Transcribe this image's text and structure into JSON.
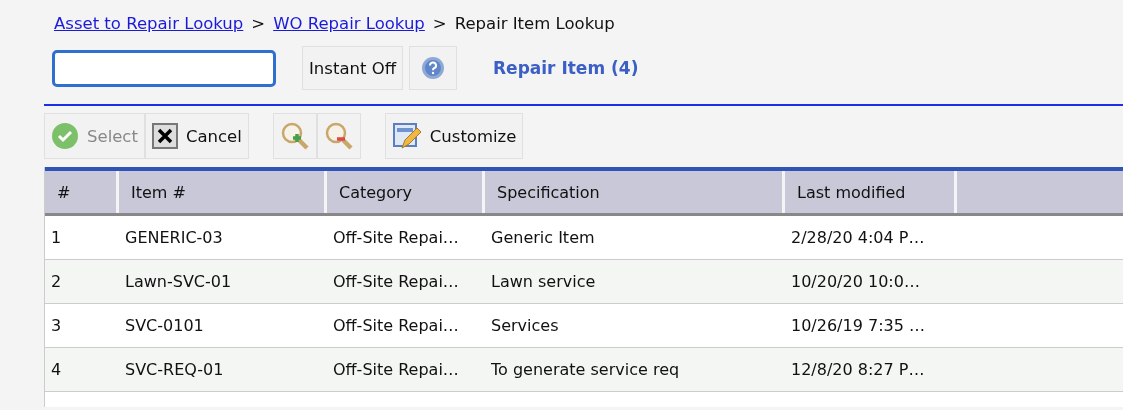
{
  "breadcrumb": [
    {
      "label": "Asset to Repair Lookup",
      "kind": "link"
    },
    {
      "label": "WO Repair Lookup",
      "kind": "link"
    },
    {
      "label": "Repair Item Lookup",
      "kind": "current"
    }
  ],
  "separator": ">",
  "instant_button": "Instant Off",
  "title": "Repair Item (4)",
  "toolbar": [
    {
      "kind": "select",
      "label": "Select",
      "disabled": true
    },
    {
      "kind": "cancel",
      "label": "Cancel",
      "disabled": false
    },
    {
      "kind": "zoom-in",
      "disabled": false
    },
    {
      "kind": "zoom-out",
      "disabled": false
    },
    {
      "kind": "customize",
      "label": "Customize",
      "disabled": false
    }
  ],
  "table": {
    "columns": [
      "#",
      "Item #",
      "Category",
      "Specification",
      "Last modified"
    ],
    "rows": [
      [
        "1",
        "GENERIC-03",
        "Off-Site Repai…",
        "Generic Item",
        "2/28/20 4:04 P…"
      ],
      [
        "2",
        "Lawn-SVC-01",
        "Off-Site Repai…",
        "Lawn service",
        "10/20/20 10:0…"
      ],
      [
        "3",
        "SVC-0101",
        "Off-Site Repai…",
        "Services",
        "10/26/19 7:35 …"
      ],
      [
        "4",
        "SVC-REQ-01",
        "Off-Site Repai…",
        "To generate service req",
        "12/8/20 8:27 P…"
      ]
    ]
  }
}
